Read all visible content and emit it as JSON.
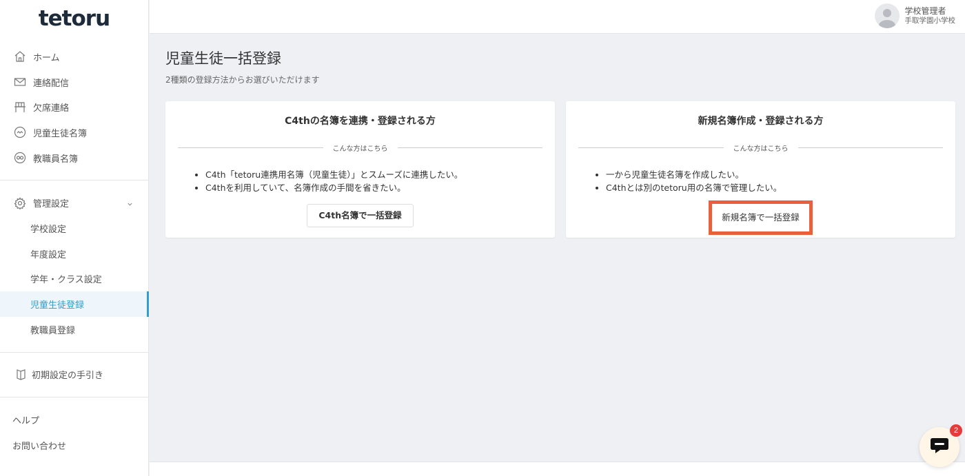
{
  "logo": {
    "text": "tetoru",
    "dot_colors": [
      "#e84a3a",
      "#f4b400",
      "#2eaf6b"
    ]
  },
  "user": {
    "role": "学校管理者",
    "school": "手取学園小学校"
  },
  "sidebar": {
    "main_items": [
      {
        "label": "ホーム",
        "icon": "home-icon"
      },
      {
        "label": "連絡配信",
        "icon": "mail-icon"
      },
      {
        "label": "欠席連絡",
        "icon": "desk-icon"
      },
      {
        "label": "児童生徒名簿",
        "icon": "student-icon"
      },
      {
        "label": "教職員名簿",
        "icon": "staff-icon"
      }
    ],
    "settings_label": "管理設定",
    "settings_items": [
      {
        "label": "学校設定"
      },
      {
        "label": "年度設定"
      },
      {
        "label": "学年・クラス設定"
      },
      {
        "label": "児童生徒登録"
      },
      {
        "label": "教職員登録"
      }
    ],
    "guide_label": "初期設定の手引き",
    "help_label": "ヘルプ",
    "contact_label": "お問い合わせ"
  },
  "page": {
    "title": "児童生徒一括登録",
    "subtitle": "2種類の登録方法からお選びいただけます"
  },
  "cards": [
    {
      "title": "C4thの名簿を連携・登録される方",
      "divider": "こんな方はこちら",
      "bullets": [
        "C4th「tetoru連携用名簿（児童生徒）」とスムーズに連携したい。",
        "C4thを利用していて、名簿作成の手間を省きたい。"
      ],
      "button": "C4th名簿で一括登録"
    },
    {
      "title": "新規名簿作成・登録される方",
      "divider": "こんな方はこちら",
      "bullets": [
        "一から児童生徒名簿を作成したい。",
        "C4thとは別のtetoru用の名簿で管理したい。"
      ],
      "button": "新規名簿で一括登録"
    }
  ],
  "chat": {
    "badge": "2"
  },
  "colors": {
    "accent": "#2e9fd0",
    "highlight": "#e8603c",
    "badge": "#e43b3b"
  }
}
